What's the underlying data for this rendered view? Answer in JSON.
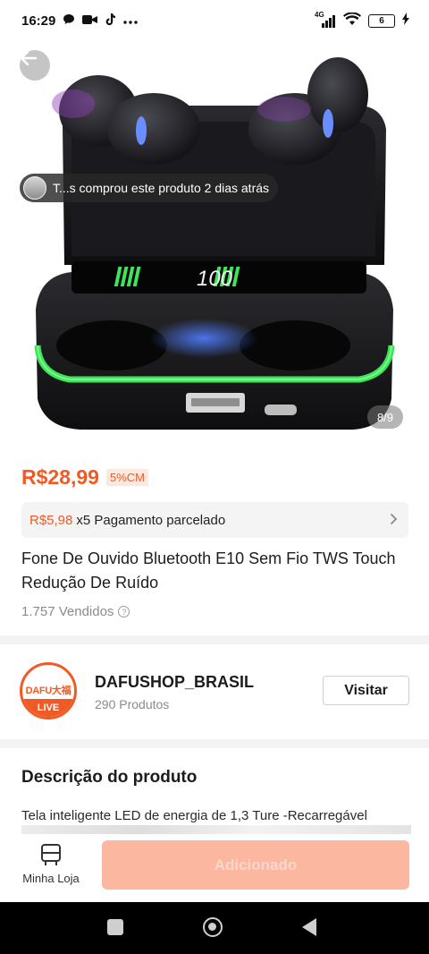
{
  "status_bar": {
    "time": "16:29",
    "left_icons": [
      "chat-bubble-icon",
      "video-camera-icon",
      "tiktok-icon",
      "more-dots-icon"
    ],
    "network_label": "4G",
    "battery_level": "6"
  },
  "hero": {
    "buyer_toast": "T...s comprou este produto 2 dias atrás",
    "image_counter": "8/9",
    "case_display": "100"
  },
  "product": {
    "price": "R$28,99",
    "discount_badge": "5%CM",
    "installment_amount": "R$5,98",
    "installment_text": "x5 Pagamento parcelado",
    "title": "Fone De Ouvido Bluetooth E10 Sem Fio TWS Touch Redução De Ruído",
    "sold": "1.757 Vendidos"
  },
  "shop": {
    "logo_text": "DAFU大福",
    "live_badge": "LIVE",
    "name": "DAFUSHOP_BRASIL",
    "products": "290 Produtos",
    "visit_label": "Visitar"
  },
  "description": {
    "heading": "Descrição do produto",
    "text": "Tela inteligente LED de energia de 1,3 Ture -Recarregável"
  },
  "action_bar": {
    "store_label": "Minha Loja",
    "add_label": "Adicionado"
  },
  "colors": {
    "accent": "#f05a24",
    "add_button": "#fbb7a0",
    "led_green": "#3ce65a"
  }
}
